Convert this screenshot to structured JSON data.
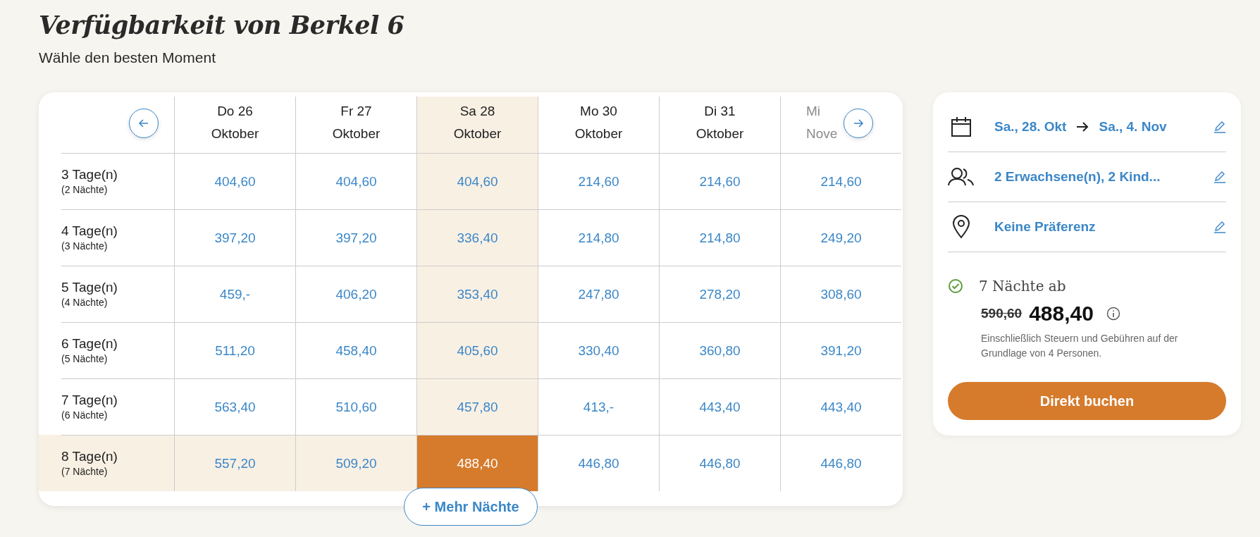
{
  "title": "Verfügbarkeit von Berkel 6",
  "subtitle": "Wähle den besten Moment",
  "days": [
    {
      "weekday": "Do 26",
      "month": "Oktober",
      "selected": false,
      "faded": false
    },
    {
      "weekday": "Fr 27",
      "month": "Oktober",
      "selected": false,
      "faded": false
    },
    {
      "weekday": "Sa 28",
      "month": "Oktober",
      "selected": true,
      "faded": false
    },
    {
      "weekday": "Mo 30",
      "month": "Oktober",
      "selected": false,
      "faded": false
    },
    {
      "weekday": "Di 31",
      "month": "Oktober",
      "selected": false,
      "faded": false
    },
    {
      "weekday": "Mi",
      "month": "Nove",
      "selected": false,
      "faded": true
    }
  ],
  "rows": [
    {
      "days": "3 Tage(n)",
      "nights": "(2 Nächte)",
      "selected": false,
      "prices": [
        "404,60",
        "404,60",
        "404,60",
        "214,60",
        "214,60",
        "214,60"
      ]
    },
    {
      "days": "4 Tage(n)",
      "nights": "(3 Nächte)",
      "selected": false,
      "prices": [
        "397,20",
        "397,20",
        "336,40",
        "214,80",
        "214,80",
        "249,20"
      ]
    },
    {
      "days": "5 Tage(n)",
      "nights": "(4 Nächte)",
      "selected": false,
      "prices": [
        "459,-",
        "406,20",
        "353,40",
        "247,80",
        "278,20",
        "308,60"
      ]
    },
    {
      "days": "6 Tage(n)",
      "nights": "(5 Nächte)",
      "selected": false,
      "prices": [
        "511,20",
        "458,40",
        "405,60",
        "330,40",
        "360,80",
        "391,20"
      ]
    },
    {
      "days": "7 Tage(n)",
      "nights": "(6 Nächte)",
      "selected": false,
      "prices": [
        "563,40",
        "510,60",
        "457,80",
        "413,-",
        "443,40",
        "443,40"
      ]
    },
    {
      "days": "8 Tage(n)",
      "nights": "(7 Nächte)",
      "selected": true,
      "prices": [
        "557,20",
        "509,20",
        "488,40",
        "446,80",
        "446,80",
        "446,80"
      ]
    }
  ],
  "more_button": "+ Mehr Nächte",
  "summary": {
    "dates": {
      "from": "Sa., 28. Okt",
      "to": "Sa., 4. Nov"
    },
    "guests": "2 Erwachsene(n), 2 Kind...",
    "location": "Keine Präferenz",
    "nights_label": "7 Nächte ab",
    "old_price": "590,60",
    "price": "488,40",
    "note": "Einschließlich Steuern und Gebühren auf der Grundlage von 4 Personen.",
    "book_button": "Direkt buchen"
  }
}
